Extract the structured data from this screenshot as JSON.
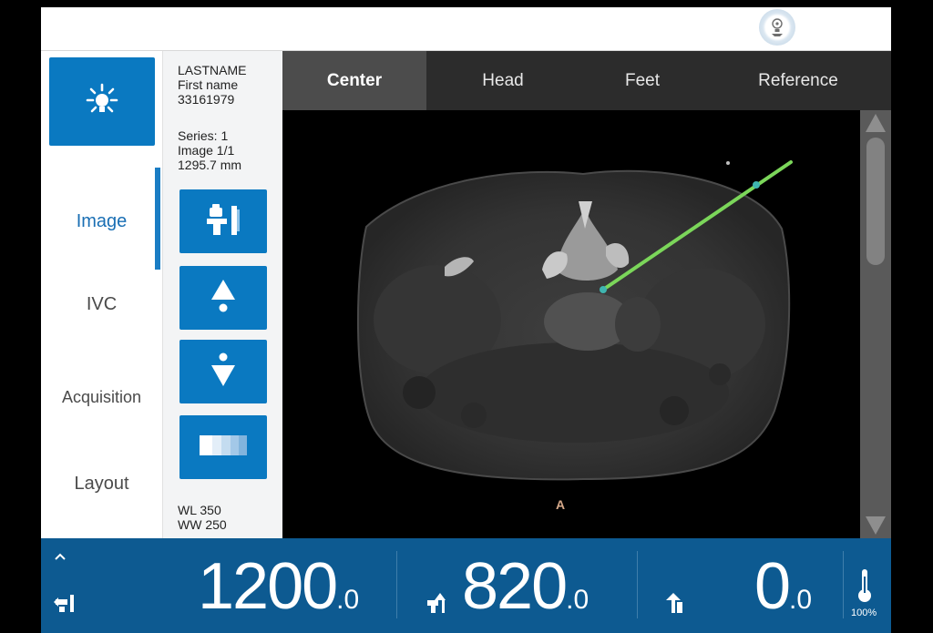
{
  "patient": {
    "lastname": "LASTNAME",
    "firstname": "First name",
    "id": "33161979"
  },
  "series": {
    "series": "Series: 1",
    "image": "Image 1/1",
    "position": "1295.7 mm"
  },
  "window": {
    "wl": "WL 350",
    "ww": "WW 250"
  },
  "nav": {
    "items": [
      {
        "label": "Image",
        "active": true
      },
      {
        "label": "IVC",
        "active": false
      },
      {
        "label": "Acquisition",
        "active": false
      },
      {
        "label": "Layout",
        "active": false
      }
    ]
  },
  "tabs": [
    {
      "label": "Center",
      "active": true
    },
    {
      "label": "Head",
      "active": false
    },
    {
      "label": "Feet",
      "active": false
    },
    {
      "label": "Reference",
      "active": false
    }
  ],
  "viewport": {
    "orientation_label": "A"
  },
  "readouts": {
    "table_height": {
      "int": "1200",
      "dec": ".0"
    },
    "table_position": {
      "int": "820",
      "dec": ".0"
    },
    "tilt": {
      "int": "0",
      "dec": ".0"
    },
    "tube_heat_percent": "100%"
  },
  "icons": {
    "lamp": "light-icon",
    "status": "gantry-status-icon",
    "table": "table-icon",
    "up": "move-up-icon",
    "down": "move-down-icon",
    "window": "windowing-icon",
    "thermometer": "thermometer-icon"
  },
  "colors": {
    "accent": "#0a79c1",
    "bottom_bar": "#0d5a91",
    "tab_bar": "#2c2c2c",
    "needle": "#7bd65a"
  }
}
